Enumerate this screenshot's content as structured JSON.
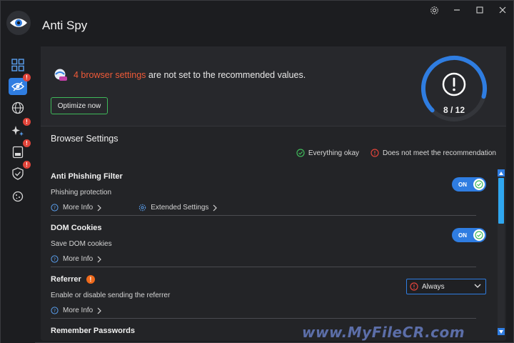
{
  "app": {
    "title": "Anti Spy"
  },
  "banner": {
    "count_text": "4 browser settings",
    "rest_text": " are not set to the recommended values.",
    "optimize_label": "Optimize now",
    "gauge_text": "8 / 12",
    "gauge_progress": 0.6667
  },
  "section": {
    "title": "Browser Settings",
    "legend_ok": "Everything okay",
    "legend_bad": "Does not meet the recommendation"
  },
  "settings": [
    {
      "name": "Anti Phishing Filter",
      "desc": "Phishing protection",
      "more": "More Info",
      "extended": "Extended Settings",
      "toggle": "ON"
    },
    {
      "name": "DOM Cookies",
      "desc": "Save DOM cookies",
      "more": "More Info",
      "toggle": "ON"
    },
    {
      "name": "Referrer",
      "desc": "Enable or disable sending the referrer",
      "more": "More Info",
      "select_value": "Always"
    },
    {
      "name": "Remember Passwords"
    }
  ],
  "watermark": "www.MyFileCR.com",
  "colors": {
    "accent": "#2f7de1",
    "warning": "#ef5a38",
    "ok": "#3fb95a",
    "background": "#1c1d20"
  }
}
